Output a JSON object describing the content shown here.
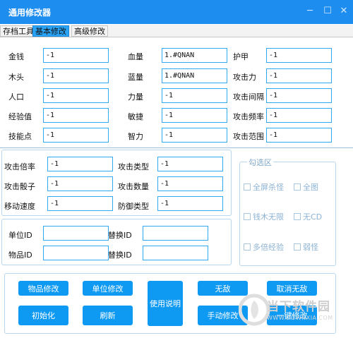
{
  "window": {
    "title": "通用修改器",
    "min_glyph": "─",
    "max_glyph": "☐",
    "close_glyph": "✕"
  },
  "tabs": [
    {
      "label": "存档工具",
      "active": false
    },
    {
      "label": "基本修改",
      "active": true
    },
    {
      "label": "高级修改",
      "active": false
    }
  ],
  "basic": {
    "col1": [
      {
        "label": "金钱",
        "value": "-1"
      },
      {
        "label": "木头",
        "value": "-1"
      },
      {
        "label": "人口",
        "value": "-1"
      },
      {
        "label": "经验值",
        "value": "-1"
      },
      {
        "label": "技能点",
        "value": "-1"
      }
    ],
    "col2": [
      {
        "label": "血量",
        "value": "1.#QNAN"
      },
      {
        "label": "蓝量",
        "value": "1.#QNAN"
      },
      {
        "label": "力量",
        "value": "-1"
      },
      {
        "label": "敏捷",
        "value": "-1"
      },
      {
        "label": "智力",
        "value": "-1"
      }
    ],
    "col3": [
      {
        "label": "护甲",
        "value": "-1"
      },
      {
        "label": "攻击力",
        "value": "-1"
      },
      {
        "label": "攻击间隔",
        "value": "-1"
      },
      {
        "label": "攻击频率",
        "value": "-1"
      },
      {
        "label": "攻击范围",
        "value": "-1"
      }
    ]
  },
  "attack": {
    "left": [
      {
        "label": "攻击倍率",
        "value": "-1"
      },
      {
        "label": "攻击骰子",
        "value": "-1"
      },
      {
        "label": "移动速度",
        "value": "-1"
      }
    ],
    "right": [
      {
        "label": "攻击类型",
        "value": "-1"
      },
      {
        "label": "攻击数量",
        "value": "-1"
      },
      {
        "label": "防御类型",
        "value": "-1"
      }
    ]
  },
  "ids": {
    "unit_label": "单位ID",
    "unit_value": "",
    "item_label": "物品ID",
    "item_value": "",
    "replace_label_1": "替换ID",
    "replace_value_1": "",
    "replace_label_2": "替换ID",
    "replace_value_2": ""
  },
  "options": {
    "title": "勾选区",
    "items": [
      {
        "label": "全屏杀怪",
        "checked": false
      },
      {
        "label": "全图",
        "checked": false
      },
      {
        "label": "钱木无限",
        "checked": false
      },
      {
        "label": "无CD",
        "checked": false
      },
      {
        "label": "多倍经验",
        "checked": false
      },
      {
        "label": "弱怪",
        "checked": false
      }
    ]
  },
  "buttons": {
    "item_modify": "物品修改",
    "unit_modify": "单位修改",
    "invincible": "无敌",
    "cancel_invincible": "取消无敌",
    "init": "初始化",
    "refresh": "刷新",
    "help": "使用说明",
    "manual_modify": "手动修改",
    "one_key_modify": "一键修改"
  },
  "watermark": {
    "text": "当下软件园",
    "url": "WWW.DOWNXIA.COM"
  },
  "colors": {
    "title_bar": "#1e8df0",
    "active_tab": "#29a3f5",
    "button": "#0e9af2",
    "field_border": "#31a8f0"
  }
}
